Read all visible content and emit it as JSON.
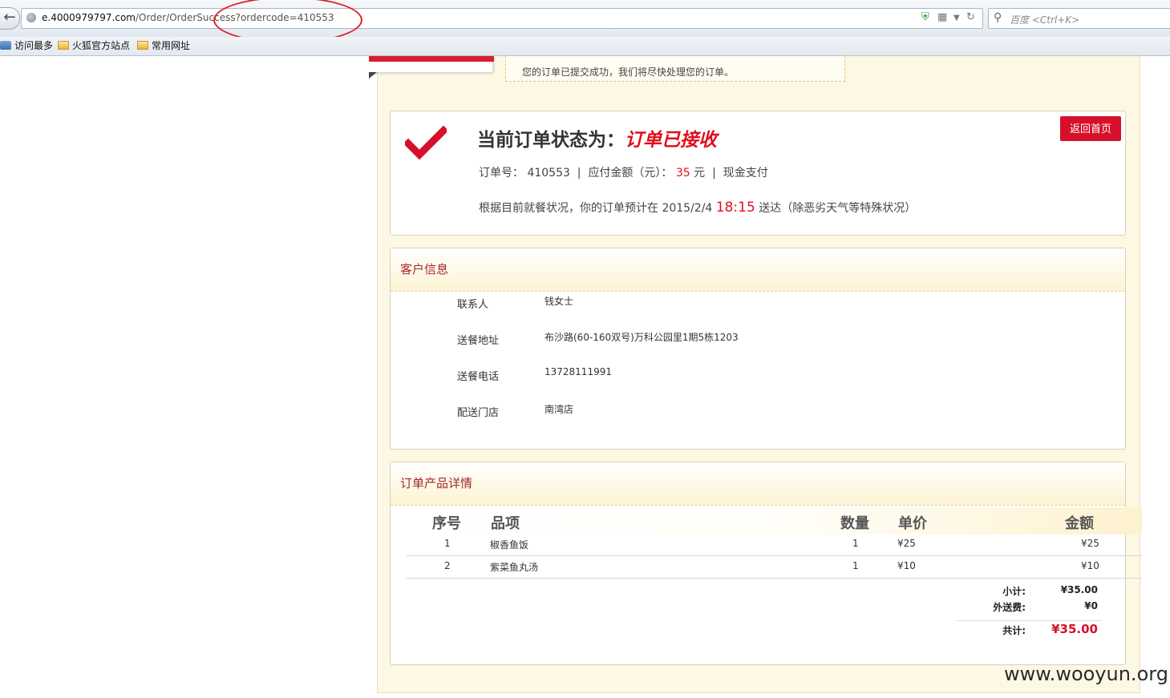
{
  "browser": {
    "url_host": "e.4000979797.com",
    "url_path": "/Order/OrderSuccess?ordercode=410553",
    "search_placeholder": "百度 <Ctrl+K>",
    "bookmarks": [
      "访问最多",
      "火狐官方站点",
      "常用网址"
    ]
  },
  "notice": {
    "text": "您的订单已提交成功，我们将尽快处理您的订单。"
  },
  "status": {
    "title": "当前订单状态为：",
    "value": "订单已接收",
    "order_no_label": "订单号：",
    "order_no": "410553",
    "amount_label": "应付金额（元）：",
    "amount": "35",
    "amount_unit": "元",
    "payment": "现金支付",
    "eta_prefix": "根据目前就餐状况，你的订单预计在 2015/2/4",
    "eta_time": "18:15",
    "eta_suffix": "送达（除恶劣天气等特殊状况）",
    "home_button": "返回首页"
  },
  "customer": {
    "title": "客户信息",
    "fields": [
      {
        "label": "联系人",
        "value": "钱女士"
      },
      {
        "label": "送餐地址",
        "value": "布沙路(60-160双号)万科公园里1期5栋1203"
      },
      {
        "label": "送餐电话",
        "value": "13728111991"
      },
      {
        "label": "配送门店",
        "value": "南湾店"
      }
    ]
  },
  "products": {
    "title": "订单产品详情",
    "headers": {
      "no": "序号",
      "item": "品项",
      "qty": "数量",
      "price": "单价",
      "amount": "金额"
    },
    "rows": [
      {
        "no": "1",
        "item": "椒香鱼饭",
        "qty": "1",
        "price": "¥25",
        "amount": "¥25"
      },
      {
        "no": "2",
        "item": "紫菜鱼丸汤",
        "qty": "1",
        "price": "¥10",
        "amount": "¥10"
      }
    ],
    "subtotal_label": "小计:",
    "subtotal": "¥35.00",
    "delivery_label": "外送费:",
    "delivery": "¥0",
    "total_label": "共计:",
    "total": "¥35.00"
  },
  "watermark": "www.wooyun.org",
  "colors": {
    "accent_red": "#d6102a",
    "section_title": "#a8262e",
    "page_bg": "#fdf8e4"
  }
}
